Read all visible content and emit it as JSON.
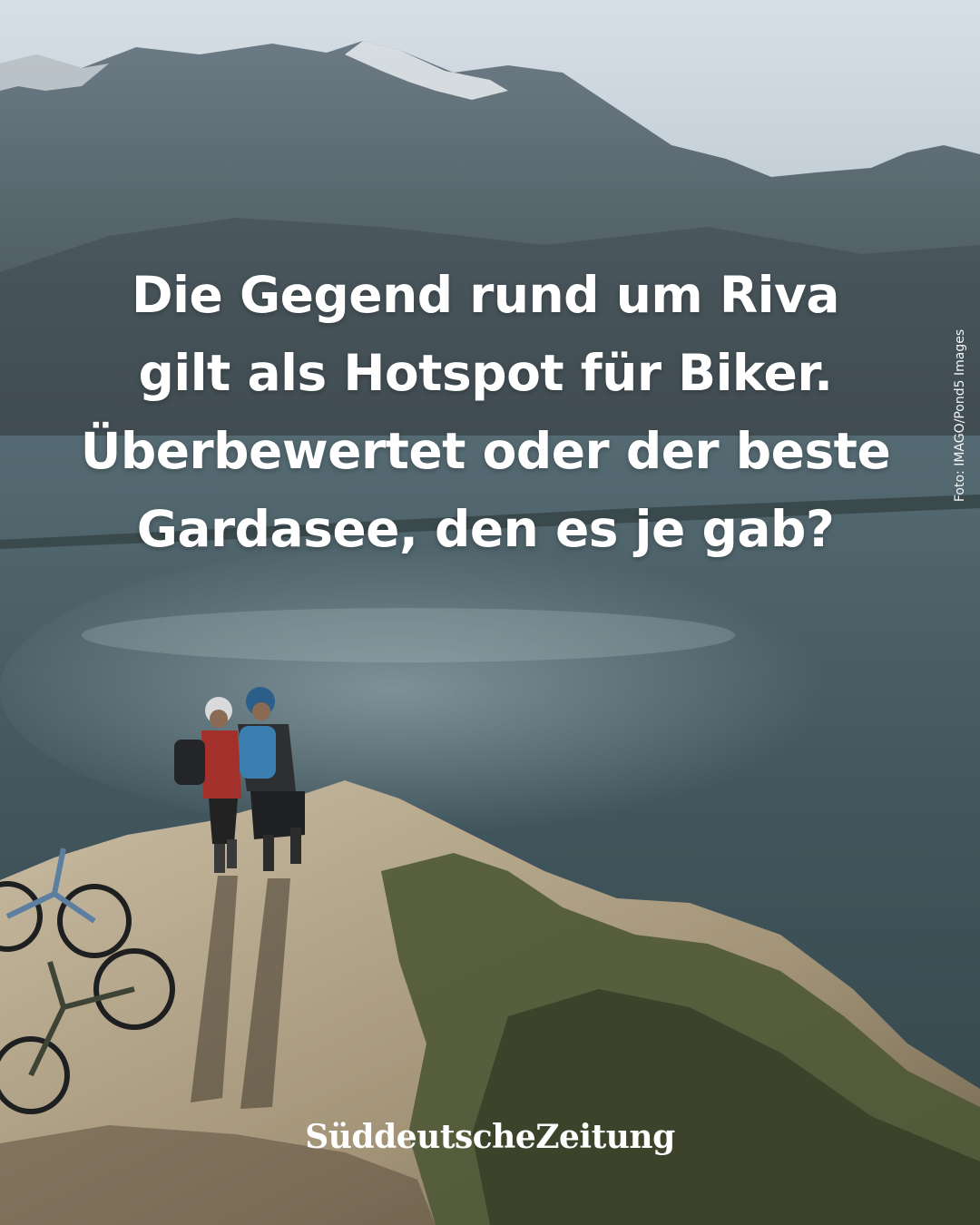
{
  "headline": {
    "lines": [
      "Die Gegend rund um Riva",
      "gilt als Hotspot für Biker.",
      "Überbewertet oder der beste",
      "Gardasee, den es je gab?"
    ]
  },
  "photo_credit": "Foto: IMAGO/Pond5 Images",
  "logo": {
    "text": "SüddeutscheZeitung"
  },
  "colors": {
    "text": "#ffffff",
    "sky": "#c9d3dc",
    "mountain": "#4f5e66",
    "lake": "#3e5057",
    "rock": "#b7a88e",
    "shrub": "#4c5534"
  },
  "icons": [
    "mountain-bike-icon",
    "cyclist-figure-icon"
  ]
}
